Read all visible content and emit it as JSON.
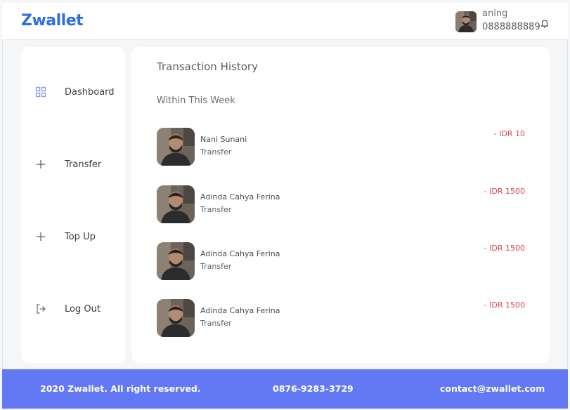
{
  "header": {
    "brand": "Zwallet",
    "user_name": "aning",
    "user_phone": "0888888889",
    "bell_icon": "bell-icon"
  },
  "sidebar": {
    "items": [
      {
        "label": "Dashboard",
        "icon": "grid-icon"
      },
      {
        "label": "Transfer",
        "icon": "plus-icon"
      },
      {
        "label": "Top Up",
        "icon": "plus-icon"
      },
      {
        "label": "Log Out",
        "icon": "logout-icon"
      }
    ]
  },
  "main": {
    "title": "Transaction History",
    "section": "Within This Week",
    "transactions": [
      {
        "name": "Nani Sunani",
        "type": "Transfer",
        "amount": "- IDR 10"
      },
      {
        "name": "Adinda Cahya Ferina",
        "type": "Transfer",
        "amount": "- IDR 1500"
      },
      {
        "name": "Adinda Cahya Ferina",
        "type": "Transfer",
        "amount": "- IDR 1500"
      },
      {
        "name": "Adinda Cahya Ferina",
        "type": "Transfer",
        "amount": "- IDR 1500"
      }
    ]
  },
  "footer": {
    "copyright": "2020 Zwallet. All right reserved.",
    "phone": "0876-9283-3729",
    "email": "contact@zwallet.com"
  },
  "colors": {
    "brand": "#2f6fe4",
    "footer_bg": "#6379f4",
    "amount_negative": "#d6474f",
    "dashboard_icon": "#8a9cf0"
  }
}
